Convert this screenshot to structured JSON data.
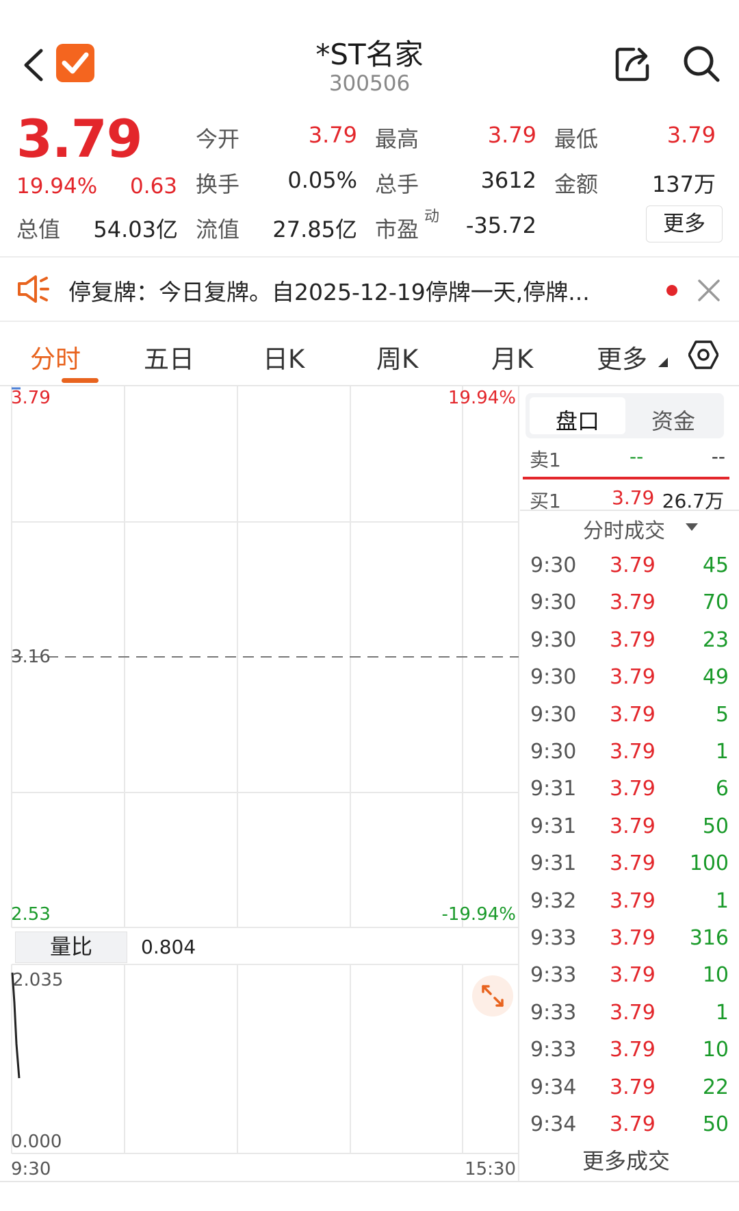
{
  "header": {
    "title": "*ST名家",
    "code": "300506"
  },
  "quote": {
    "price": "3.79",
    "change_pct": "19.94%",
    "change_amt": "0.63",
    "stats": [
      {
        "label": "今开",
        "value": "3.79"
      },
      {
        "label": "最高",
        "value": "3.79"
      },
      {
        "label": "最低",
        "value": "3.79"
      },
      {
        "label": "换手",
        "value": "0.05%"
      },
      {
        "label": "总手",
        "value": "3612"
      },
      {
        "label": "金额",
        "value": "137万"
      },
      {
        "label": "总值",
        "value": "54.03亿"
      },
      {
        "label": "流值",
        "value": "27.85亿"
      },
      {
        "label": "市盈",
        "value": "-35.72"
      }
    ],
    "pe_sup": "动",
    "more_label": "更多"
  },
  "notice": {
    "text": "停复牌：今日复牌。自2025-12-19停牌一天,停牌..."
  },
  "tabs": [
    "分时",
    "五日",
    "日K",
    "周K",
    "月K",
    "更多"
  ],
  "chart": {
    "price_high": "3.79",
    "price_mid": "3.16",
    "price_low": "2.53",
    "pct_high": "19.94%",
    "pct_low": "-19.94%",
    "ratio_label": "量比",
    "ratio_value": "0.804",
    "vol_max": "2.035",
    "vol_min": "0.000",
    "time_start": "9:30",
    "time_end": "15:30"
  },
  "orderbook": {
    "tabs": [
      "盘口",
      "资金"
    ],
    "sell1_label": "卖1",
    "sell1_price": "--",
    "sell1_vol": "--",
    "buy1_label": "买1",
    "buy1_price": "3.79",
    "buy1_vol": "26.7万",
    "trades_header": "分时成交",
    "trades": [
      {
        "time": "9:30",
        "price": "3.79",
        "vol": "45"
      },
      {
        "time": "9:30",
        "price": "3.79",
        "vol": "70"
      },
      {
        "time": "9:30",
        "price": "3.79",
        "vol": "23"
      },
      {
        "time": "9:30",
        "price": "3.79",
        "vol": "49"
      },
      {
        "time": "9:30",
        "price": "3.79",
        "vol": "5"
      },
      {
        "time": "9:30",
        "price": "3.79",
        "vol": "1"
      },
      {
        "time": "9:31",
        "price": "3.79",
        "vol": "6"
      },
      {
        "time": "9:31",
        "price": "3.79",
        "vol": "50"
      },
      {
        "time": "9:31",
        "price": "3.79",
        "vol": "100"
      },
      {
        "time": "9:32",
        "price": "3.79",
        "vol": "1"
      },
      {
        "time": "9:33",
        "price": "3.79",
        "vol": "316"
      },
      {
        "time": "9:33",
        "price": "3.79",
        "vol": "10"
      },
      {
        "time": "9:33",
        "price": "3.79",
        "vol": "1"
      },
      {
        "time": "9:33",
        "price": "3.79",
        "vol": "10"
      },
      {
        "time": "9:34",
        "price": "3.79",
        "vol": "22"
      },
      {
        "time": "9:34",
        "price": "3.79",
        "vol": "50"
      }
    ],
    "more_trades_label": "更多成交"
  },
  "colors": {
    "up": "#e3262b",
    "down": "#1a9a2a",
    "accent": "#e8631e"
  }
}
